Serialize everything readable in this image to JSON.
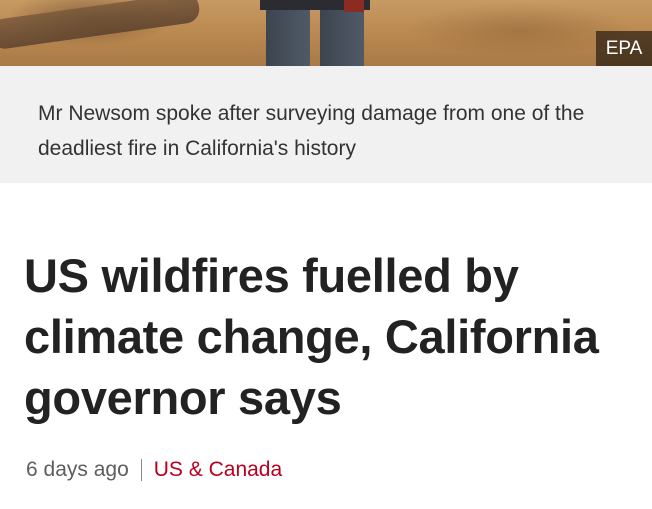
{
  "photo": {
    "credit": "EPA"
  },
  "caption": {
    "text": "Mr Newsom spoke after surveying damage from one of the deadliest fire in California's history"
  },
  "article": {
    "headline": "US wildfires fuelled by climate change, California governor says",
    "timestamp": "6 days ago",
    "section": "US & Canada"
  },
  "colors": {
    "section_link": "#b8001f",
    "caption_bg": "#f1f1f1"
  }
}
